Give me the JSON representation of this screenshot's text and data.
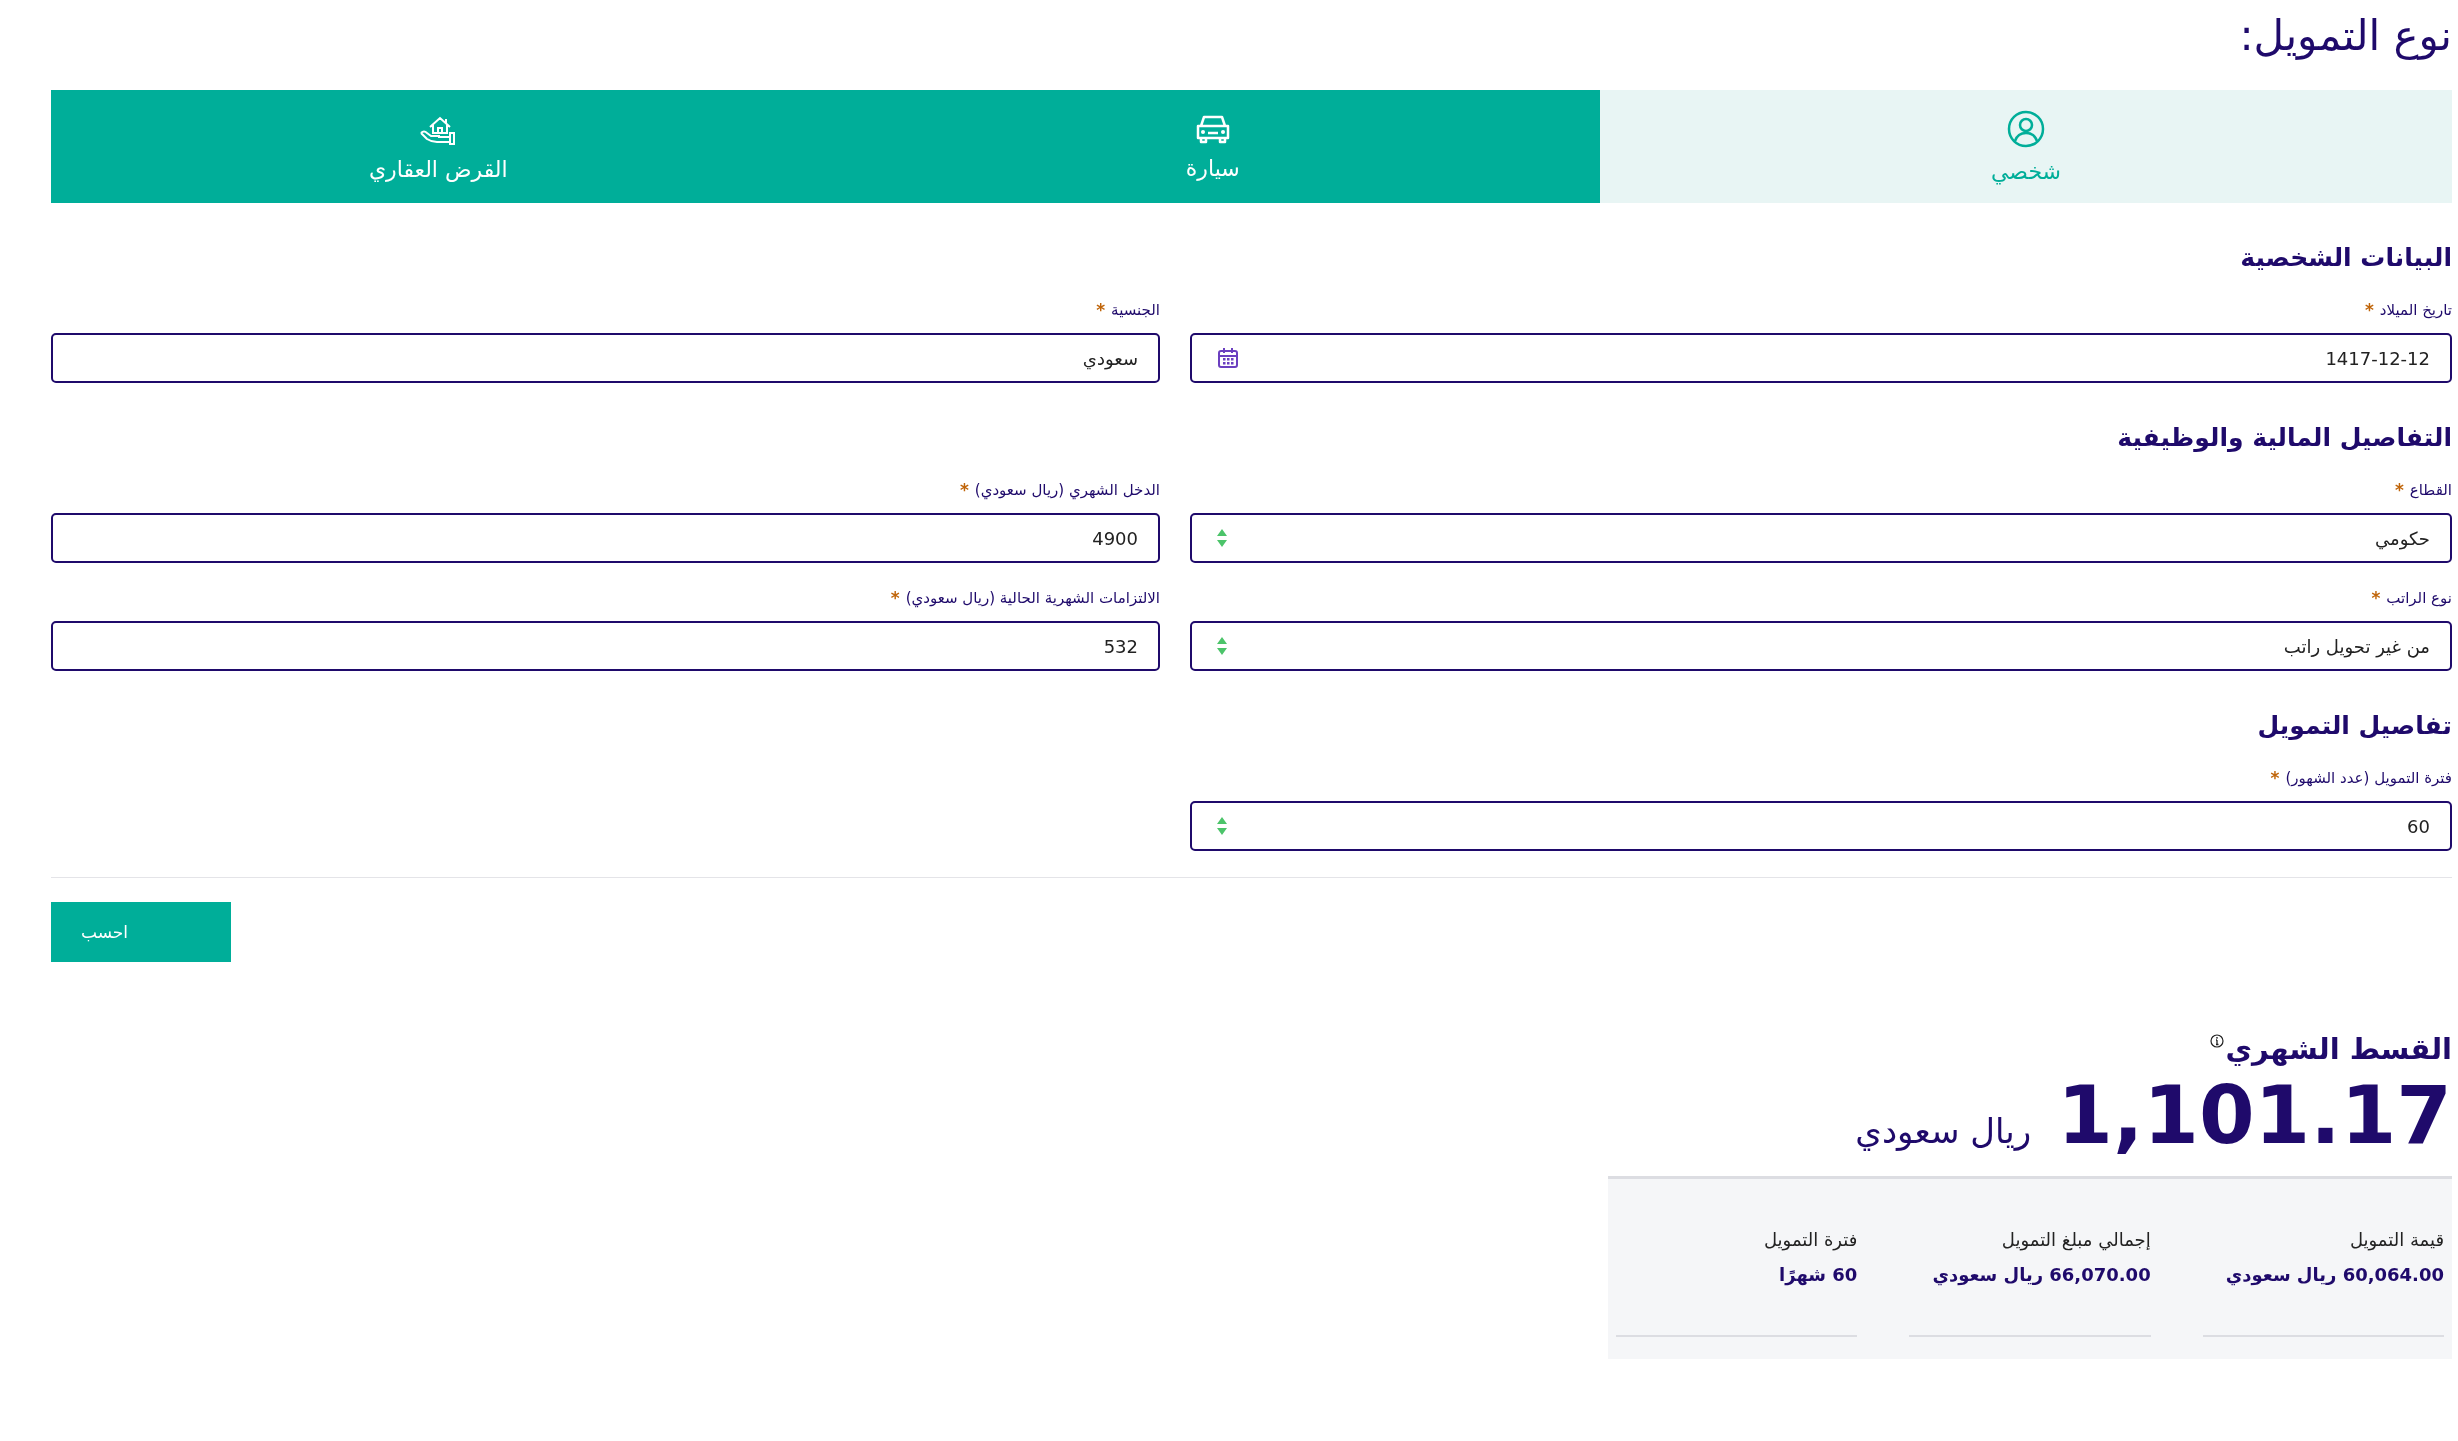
{
  "page_title": "نوع التمويل:",
  "tabs": [
    {
      "label": "شخصي",
      "selected": true
    },
    {
      "label": "سيارة",
      "selected": false
    },
    {
      "label": "القرض العقاري",
      "selected": false
    }
  ],
  "sections": [
    {
      "title": "البيانات الشخصية",
      "rows": [
        [
          {
            "label": "تاريخ الميلاد",
            "required_mark": "*",
            "value": "1417-12-12",
            "kind": "date"
          },
          {
            "label": "الجنسية",
            "required_mark": "*",
            "value": "سعودي",
            "kind": "text"
          }
        ]
      ]
    },
    {
      "title": "التفاصيل المالية والوظيفية",
      "rows": [
        [
          {
            "label": "القطاع",
            "required_mark": "*",
            "value": "حكومي",
            "kind": "select"
          },
          {
            "label": "الدخل الشهري (ريال سعودي)",
            "required_mark": "*",
            "value": "4900",
            "kind": "text"
          }
        ],
        [
          {
            "label": "نوع الراتب",
            "required_mark": "*",
            "value": "من غير تحويل راتب",
            "kind": "select"
          },
          {
            "label": "الالتزامات الشهرية الحالية (ريال سعودي)",
            "required_mark": "*",
            "value": "532",
            "kind": "text"
          }
        ]
      ]
    },
    {
      "title": "تفاصيل التمويل",
      "rows": [
        [
          {
            "label": "فترة التمويل (عدد الشهور)",
            "required_mark": "*",
            "value": "60",
            "kind": "select"
          }
        ]
      ]
    }
  ],
  "calculate_button": "احسب",
  "result": {
    "title": "القسط الشهري",
    "amount": "1,101.17",
    "currency": "ريال سعودي",
    "summary": [
      {
        "label": "قيمة التمويل",
        "value": "60,064.00 ريال سعودي"
      },
      {
        "label": "إجمالي مبلغ التمويل",
        "value": "66,070.00 ريال سعودي"
      },
      {
        "label": "فترة التمويل",
        "value": "60 شهرًا"
      }
    ]
  }
}
